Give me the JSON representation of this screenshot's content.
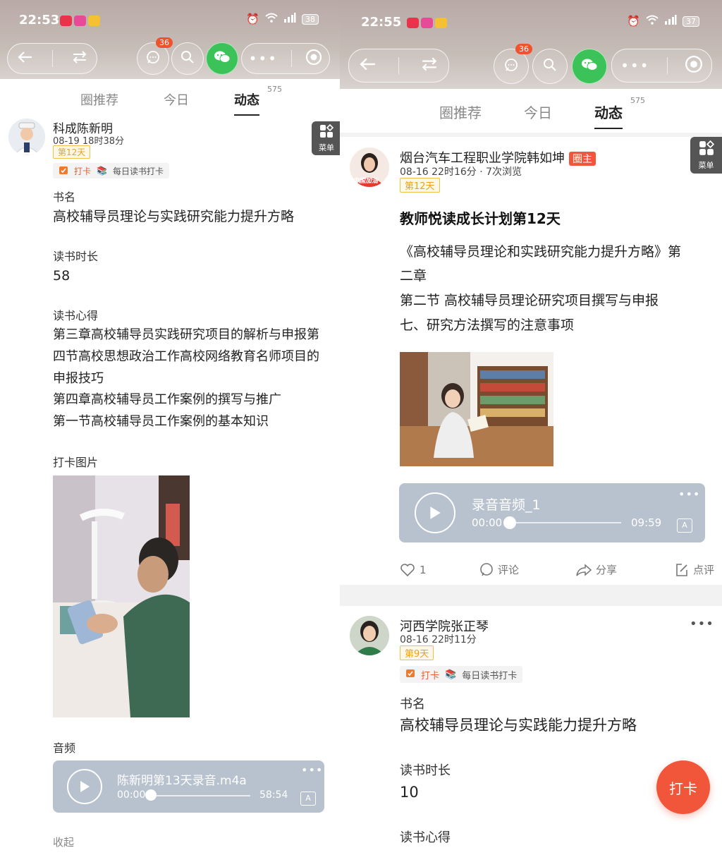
{
  "left": {
    "status": {
      "time": "22:53",
      "battery": "38"
    },
    "nav": {
      "notif_count": "36"
    },
    "tabs": [
      {
        "label": "圈推荐"
      },
      {
        "label": "今日"
      },
      {
        "label": "动态",
        "count": "575"
      }
    ],
    "menu_label": "菜单",
    "post": {
      "author": "科成陈新明",
      "time": "08-19 18时38分",
      "day_tag": "第12天",
      "chip_punch": "打卡",
      "chip_topic": "每日读书打卡",
      "book_label": "书名",
      "book_value": "高校辅导员理论与实践研究能力提升方略",
      "duration_label": "读书时长",
      "duration_value": "58",
      "notes_label": "读书心得",
      "notes_lines": [
        "第三章高校辅导员实践研究项目的解析与申报第",
        "四节高校思想政治工作高校网络教育名师项目的",
        "申报技巧",
        "第四章高校辅导员工作案例的撰写与推广",
        "第一节高校辅导员工作案例的基本知识"
      ],
      "photo_label": "打卡图片",
      "audio_label": "音频",
      "audio": {
        "name": "陈新明第13天录音.m4a",
        "current": "00:00",
        "total": "58:54"
      },
      "collapse": "收起"
    }
  },
  "right": {
    "status": {
      "time": "22:55",
      "battery": "37"
    },
    "nav": {
      "notif_count": "36"
    },
    "tabs": [
      {
        "label": "圈推荐"
      },
      {
        "label": "今日"
      },
      {
        "label": "动态",
        "count": "575"
      }
    ],
    "menu_label": "菜单",
    "post1": {
      "author": "烟台汽车工程职业学院韩如坤",
      "owner_tag": "圈主",
      "time": "08-16 22时16分 · 7次浏览",
      "day_tag": "第12天",
      "title": "教师悦读成长计划第12天",
      "body_lines": [
        "《高校辅导员理论和实践研究能力提升方略》第",
        "二章",
        "第二节 高校辅导员理论研究项目撰写与申报",
        "七、研究方法撰写的注意事项"
      ],
      "avatar_caption": "中国加油",
      "audio": {
        "name": "录音音频_1",
        "current": "00:00",
        "total": "09:59"
      },
      "actions": {
        "likes": "1",
        "comment": "评论",
        "share": "分享",
        "review": "点评"
      }
    },
    "post2": {
      "author": "河西学院张正琴",
      "time": "08-16 22时11分",
      "day_tag": "第9天",
      "chip_punch": "打卡",
      "chip_topic": "每日读书打卡",
      "book_label": "书名",
      "book_value": "高校辅导员理论与实践能力提升方略",
      "duration_label": "读书时长",
      "duration_value": "10",
      "notes_label": "读书心得"
    },
    "fab_label": "打卡"
  },
  "colors": {
    "accent": "#f2563a",
    "tag_gold": "#e8a21b",
    "audio_bg": "#b8c2cf"
  }
}
